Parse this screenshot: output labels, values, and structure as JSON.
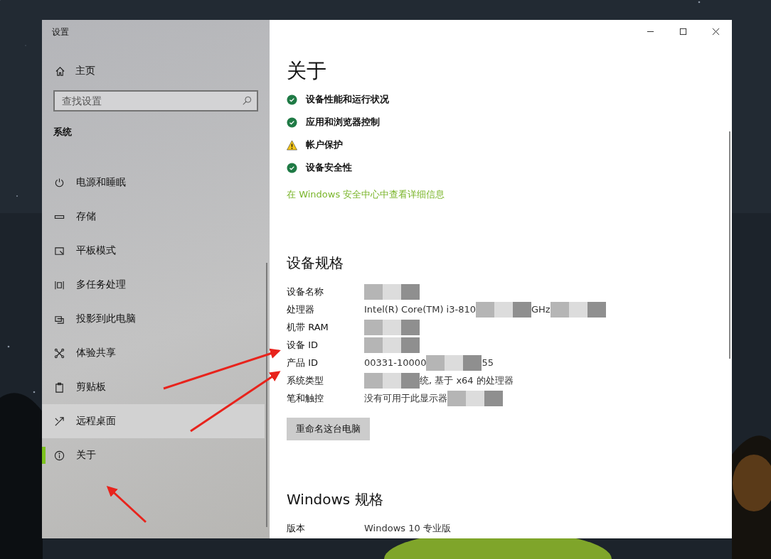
{
  "window": {
    "title": "设置"
  },
  "sidebar": {
    "home": "主页",
    "search": {
      "placeholder": "查找设置"
    },
    "section": "系统",
    "items": [
      {
        "label": "电源和睡眠",
        "selected": false,
        "hovered": false
      },
      {
        "label": "存储",
        "selected": false,
        "hovered": false
      },
      {
        "label": "平板模式",
        "selected": false,
        "hovered": false
      },
      {
        "label": "多任务处理",
        "selected": false,
        "hovered": false
      },
      {
        "label": "投影到此电脑",
        "selected": false,
        "hovered": false
      },
      {
        "label": "体验共享",
        "selected": false,
        "hovered": false
      },
      {
        "label": "剪贴板",
        "selected": false,
        "hovered": false
      },
      {
        "label": "远程桌面",
        "selected": false,
        "hovered": true
      },
      {
        "label": "关于",
        "selected": true,
        "hovered": false
      }
    ]
  },
  "content": {
    "title": "关于",
    "security_items": [
      {
        "label": "设备性能和运行状况",
        "kind": "ok"
      },
      {
        "label": "应用和浏览器控制",
        "kind": "ok"
      },
      {
        "label": "帐户保护",
        "kind": "warning"
      },
      {
        "label": "设备安全性",
        "kind": "ok"
      }
    ],
    "security_link": "在 Windows 安全中心中查看详细信息",
    "device_specs": {
      "heading": "设备规格",
      "rows": [
        {
          "label": "设备名称",
          "value_parts": [
            {
              "kind": "redacted"
            }
          ]
        },
        {
          "label": "处理器",
          "value_parts": [
            {
              "kind": "text",
              "text": "Intel(R) Core(TM) i3-810"
            },
            {
              "kind": "redacted"
            },
            {
              "kind": "text",
              "text": "GHz"
            },
            {
              "kind": "redacted"
            }
          ]
        },
        {
          "label": "机带 RAM",
          "value_parts": [
            {
              "kind": "redacted"
            }
          ]
        },
        {
          "label": "设备 ID",
          "value_parts": [
            {
              "kind": "redacted"
            }
          ]
        },
        {
          "label": "产品 ID",
          "value_parts": [
            {
              "kind": "text",
              "text": "00331-10000"
            },
            {
              "kind": "redacted"
            },
            {
              "kind": "text",
              "text": "55"
            }
          ]
        },
        {
          "label": "系统类型",
          "value_parts": [
            {
              "kind": "redacted"
            },
            {
              "kind": "text",
              "text": "统, 基于 x64 的处理器"
            }
          ]
        },
        {
          "label": "笔和触控",
          "value_parts": [
            {
              "kind": "text",
              "text": "没有可用于此显示器"
            },
            {
              "kind": "redacted"
            }
          ]
        }
      ],
      "rename_button": "重命名这台电脑"
    },
    "windows_specs": {
      "heading": "Windows 规格",
      "rows": [
        {
          "label": "版本",
          "value": "Windows 10 专业版"
        }
      ]
    }
  }
}
